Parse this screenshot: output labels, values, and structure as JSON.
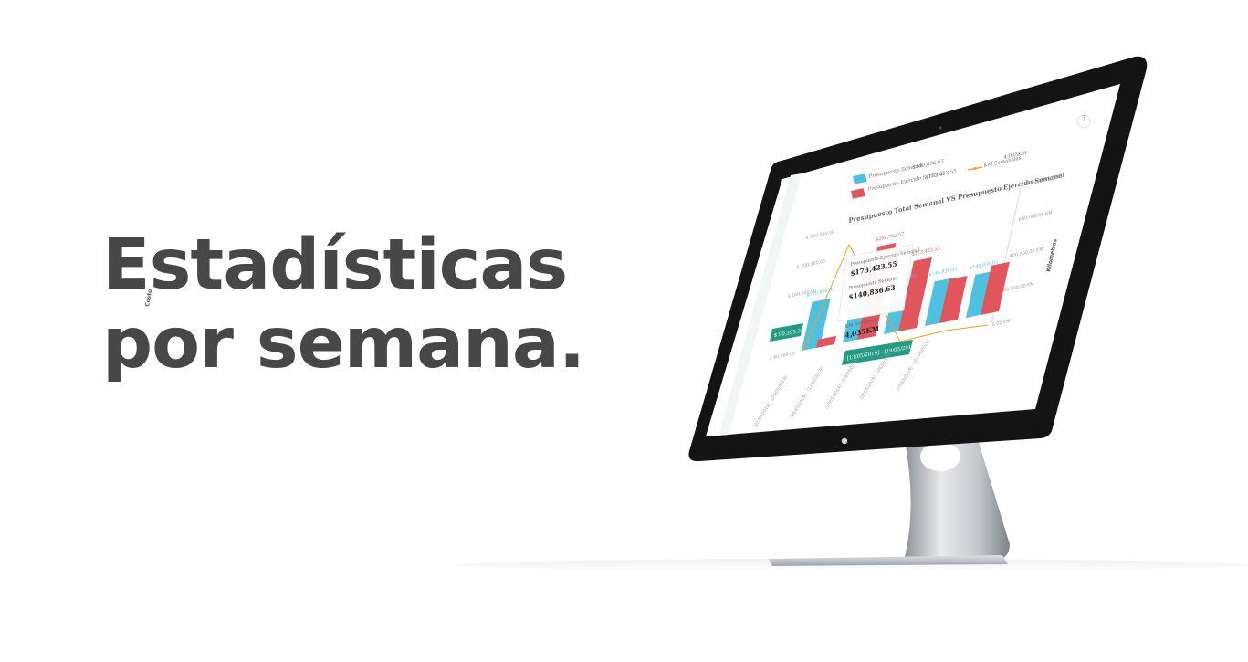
{
  "headline": {
    "line1": "Estadísticas",
    "line2": "por semana."
  },
  "colors": {
    "bar_primary": "#4fc1e0",
    "bar_secondary": "#e2555c",
    "accent_teal": "#239b85",
    "line_km": "#f0a020",
    "text_dark": "#474747"
  },
  "screen": {
    "legend": {
      "items": [
        {
          "label": "Presupuesto Semanal",
          "value": "$140,836.63",
          "color": "#4fc1e0"
        },
        {
          "label": "Presupuesto Ejercido Semanal",
          "value": "$173,423.55",
          "color": "#e2555c"
        },
        {
          "label": "KM Semanales",
          "value": "4,035KM",
          "color": "#f0a020"
        }
      ]
    },
    "chart_title": "Presupuesto Total Semanal VS Presupuesto Ejercido Semanal",
    "y_left_label": "Costo",
    "y_right_label": "Kilometros",
    "y_left_ticks": [
      "$ 240,000.00",
      "$ 200,000.00",
      "$ 160,000.00",
      "$ 80,000.00"
    ],
    "y_right_ticks": [
      "800,000.00 KM",
      "600,000.00 KM",
      "400,000.00 KM",
      "200,000.00 KM",
      "0.00 KM"
    ],
    "left_badge": "$ 90,395.35",
    "tooltip": {
      "row1_label": "Presupuesto Ejercido Semanal",
      "row1_value": "$173,423.55",
      "row2_label": "Presupuesto Semanal",
      "row2_value": "$140,836.63",
      "row3_label": "KM Semanales",
      "row3_value": "4,035KM"
    },
    "bottom_badge": "[13/05/2019] - [19/05/2019]",
    "x_ticks": [
      "[01/05/2019] - [05/05/2019]",
      "[06/05/2019] - [12/05/2019]",
      "[13/05/2019] - [19/05/2019]",
      "[20/05/2019] - [26/05/2019]",
      "[27/05/2019] - [31/05/2019]"
    ]
  },
  "chart_data": {
    "type": "bar",
    "title": "Presupuesto Total Semanal VS Presupuesto Ejercido Semanal",
    "categories": [
      "[01/05/2019] - [05/05/2019]",
      "[06/05/2019] - [12/05/2019]",
      "[13/05/2019] - [19/05/2019]",
      "[20/05/2019] - [26/05/2019]",
      "[27/05/2019] - [31/05/2019]"
    ],
    "series": [
      {
        "name": "Presupuesto Semanal",
        "values": [
          140836.63,
          140836.63,
          140836.63,
          140836.63,
          140836.63
        ],
        "labels": [
          "$140,836.63",
          "$140,836.63",
          "$140,836.63",
          "$140,836.63",
          "$140,836.63"
        ]
      },
      {
        "name": "Presupuesto Ejercido Semanal",
        "values": [
          90395.35,
          200000,
          173423.55,
          140000,
          150000
        ],
        "labels": [
          "",
          "$200,702.57",
          "$173,423.55",
          "",
          ""
        ]
      },
      {
        "name": "KM Semanales",
        "values": [
          0,
          140000,
          4035,
          4035,
          4035
        ]
      }
    ],
    "ylabel": "Costo",
    "y2label": "Kilometros",
    "ylim": [
      80000,
      240000
    ],
    "legend": "top"
  }
}
